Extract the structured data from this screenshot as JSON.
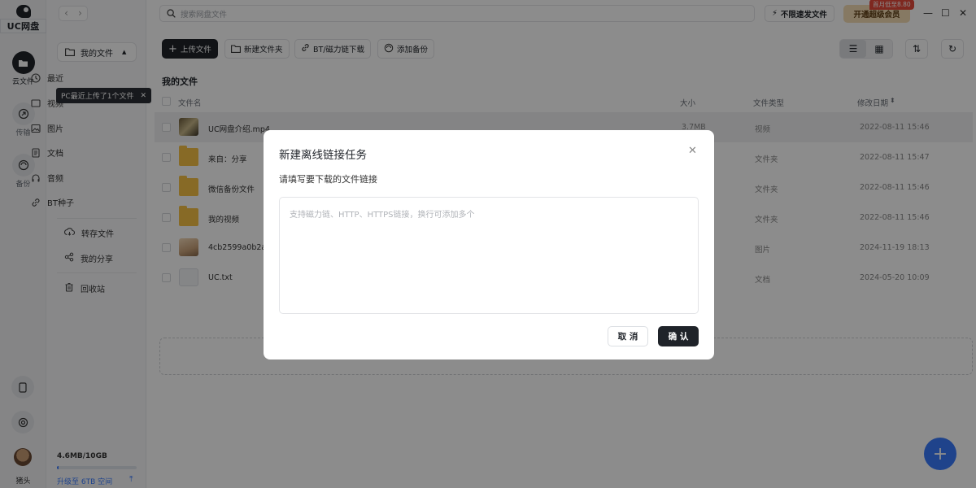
{
  "app": {
    "name": "UC网盘"
  },
  "rail": {
    "items": [
      {
        "label": "云文件",
        "icon": "folder-icon"
      },
      {
        "label": "传输",
        "icon": "transfer-icon"
      },
      {
        "label": "备份",
        "icon": "backup-icon"
      }
    ],
    "user_name": "猪头"
  },
  "sidebar": {
    "my_files": "我的文件",
    "items": [
      {
        "label": "最近",
        "icon": "clock-icon"
      },
      {
        "label": "视频",
        "icon": "video-icon"
      },
      {
        "label": "图片",
        "icon": "image-icon"
      },
      {
        "label": "文档",
        "icon": "document-icon"
      },
      {
        "label": "音频",
        "icon": "headphones-icon"
      },
      {
        "label": "BT种子",
        "icon": "link-icon"
      }
    ],
    "transfer": "转存文件",
    "share": "我的分享",
    "trash": "回收站",
    "tooltip": "PC最近上传了1个文件",
    "storage": "4.6MB/10GB",
    "storage_fraction": 0.0005,
    "upgrade": "升级至 6TB 空间"
  },
  "topbar": {
    "search_placeholder": "搜索网盘文件",
    "speed_label": "不限速发文件",
    "vip_label": "开通超级会员",
    "vip_tag": "首月低至8.80"
  },
  "toolbar": {
    "upload": "上传文件",
    "new_folder": "新建文件夹",
    "bt": "BT/磁力链下载",
    "backup": "添加备份"
  },
  "main": {
    "title": "我的文件",
    "columns": {
      "name": "文件名",
      "size": "大小",
      "type": "文件类型",
      "date": "修改日期"
    },
    "rows": [
      {
        "name": "UC网盘介绍.mp4",
        "size": "3.7MB",
        "type": "视频",
        "date": "2022-08-11 15:46",
        "kind": "video"
      },
      {
        "name": "来自：分享",
        "size": "",
        "type": "文件夹",
        "date": "2022-08-11 15:47",
        "kind": "folder"
      },
      {
        "name": "微信备份文件",
        "size": "",
        "type": "文件夹",
        "date": "2022-08-11 15:46",
        "kind": "folder"
      },
      {
        "name": "我的视频",
        "size": "",
        "type": "文件夹",
        "date": "2022-08-11 15:46",
        "kind": "folder"
      },
      {
        "name": "4cb2599a0b2a8",
        "size": "",
        "type": "图片",
        "date": "2024-11-19 18:13",
        "kind": "image"
      },
      {
        "name": "UC.txt",
        "size": "",
        "type": "文档",
        "date": "2024-05-20 10:09",
        "kind": "text"
      }
    ]
  },
  "modal": {
    "title": "新建离线链接任务",
    "label": "请填写要下载的文件链接",
    "placeholder": "支持磁力链、HTTP、HTTPS链接，换行可添加多个",
    "value": "",
    "cancel": "取 消",
    "confirm": "确 认"
  },
  "colors": {
    "accent": "#3a7afe",
    "primary": "#1f2329",
    "folder": "#f6c245",
    "vip": "#f5ddb4"
  }
}
